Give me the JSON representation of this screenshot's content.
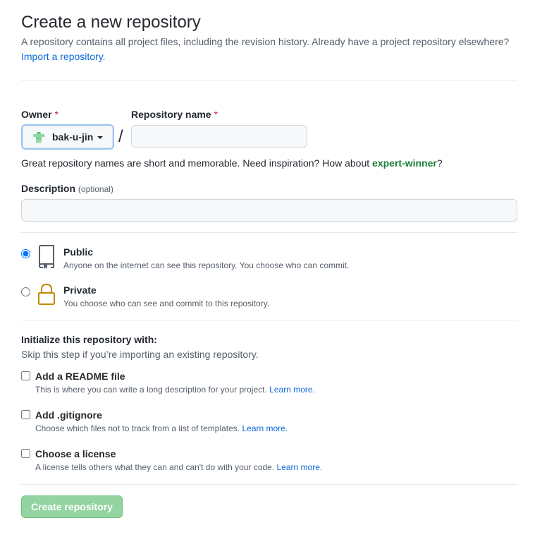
{
  "header": {
    "title": "Create a new repository",
    "subtitle": "A repository contains all project files, including the revision history. Already have a project repository elsewhere?",
    "import_link": "Import a repository."
  },
  "owner": {
    "label": "Owner",
    "required_mark": "*",
    "value": "bak-u-jin",
    "avatar_icon": "shirt-avatar-icon"
  },
  "repo_name": {
    "label": "Repository name",
    "required_mark": "*",
    "value": "",
    "separator": "/"
  },
  "hint": {
    "text": "Great repository names are short and memorable. Need inspiration? How about ",
    "suggestion": "expert-winner",
    "end": "?"
  },
  "description": {
    "label": "Description",
    "optional": "(optional)",
    "value": ""
  },
  "visibility": {
    "selected": "public",
    "options": [
      {
        "key": "public",
        "title": "Public",
        "desc": "Anyone on the internet can see this repository. You choose who can commit.",
        "icon": "repo-icon"
      },
      {
        "key": "private",
        "title": "Private",
        "desc": "You choose who can see and commit to this repository.",
        "icon": "lock-icon"
      }
    ]
  },
  "initialize": {
    "heading": "Initialize this repository with:",
    "sub": "Skip this step if you’re importing an existing repository.",
    "options": [
      {
        "title": "Add a README file",
        "desc": "This is where you can write a long description for your project.",
        "link": "Learn more.",
        "checked": false
      },
      {
        "title": "Add .gitignore",
        "desc": "Choose which files not to track from a list of templates.",
        "link": "Learn more.",
        "checked": false
      },
      {
        "title": "Choose a license",
        "desc": "A license tells others what they can and can't do with your code.",
        "link": "Learn more.",
        "checked": false
      }
    ]
  },
  "submit": {
    "label": "Create repository",
    "enabled": false
  },
  "colors": {
    "link": "#0969da",
    "required": "#cf222e",
    "suggestion": "#1a7f37",
    "button_disabled": "#94d3a2",
    "lock_icon": "#bf8700"
  }
}
